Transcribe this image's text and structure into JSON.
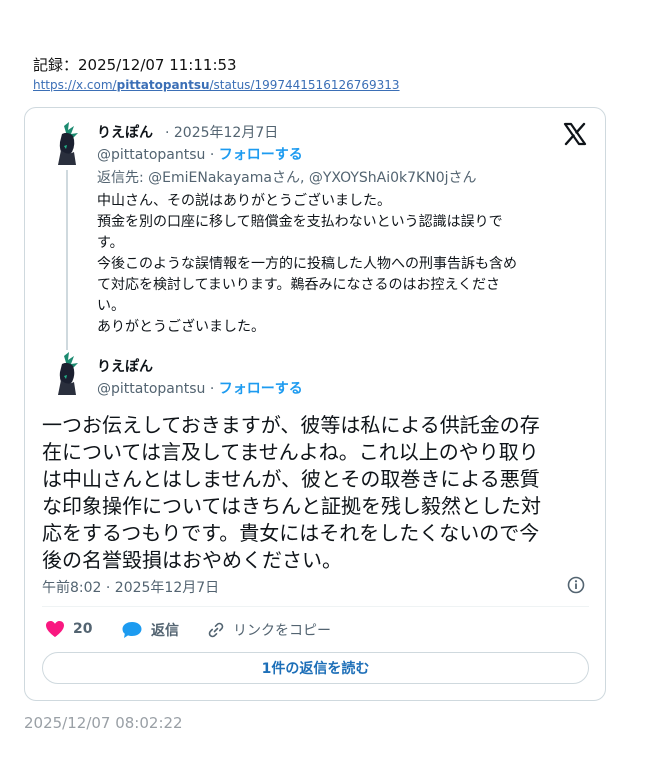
{
  "record": {
    "label": "記録：2025/12/07 11:11:53"
  },
  "link": {
    "prefix": "https://x.com/",
    "user": "pittatopantsu",
    "suffix": "/status/1997441516126769313"
  },
  "quoted_tweet": {
    "name": "りえぽん",
    "date": "· 2025年12月7日",
    "handle": "@pittatopantsu ·",
    "follow": "フォローする",
    "reply_to": "返信先: @EmiENakayamaさん, @YXOYShAi0k7KN0jさん",
    "text": "中山さん、その説はありがとうございました。\n預金を別の口座に移して賠償金を支払わないという認識は誤りで\nす。\n今後このような誤情報を一方的に投稿した人物への刑事告訴も含め\nて対応を検討してまいります。鵜呑みになさるのはお控えくださ\nい。\nありがとうございました。"
  },
  "main_tweet": {
    "name": "りえぽん",
    "handle": "@pittatopantsu ·",
    "follow": "フォローする",
    "text": "一つお伝えしておきますが、彼等は私による供託金の存\n在については言及してませんよね。これ以上のやり取り\nは中山さんとはしませんが、彼とその取巻きによる悪質\nな印象操作についてはきちんと証拠を残し毅然とした対\n応をするつもりです。貴女にはそれをしたくないので今\n後の名誉毀損はおやめください。",
    "timestamp": "午前8:02 · 2025年12月7日"
  },
  "actions": {
    "like_count": "20",
    "reply_label": "返信",
    "copy_link_label": "リンクをコピー",
    "read_replies_label": "1件の返信を読む"
  },
  "icons": [
    "x-logo-icon",
    "info-icon",
    "heart-icon",
    "reply-icon",
    "link-icon"
  ],
  "colors": {
    "accent": "#1d9bf0",
    "like": "#f91880",
    "secondary": "#536471"
  },
  "capture_time": "2025/12/07 08:02:22"
}
